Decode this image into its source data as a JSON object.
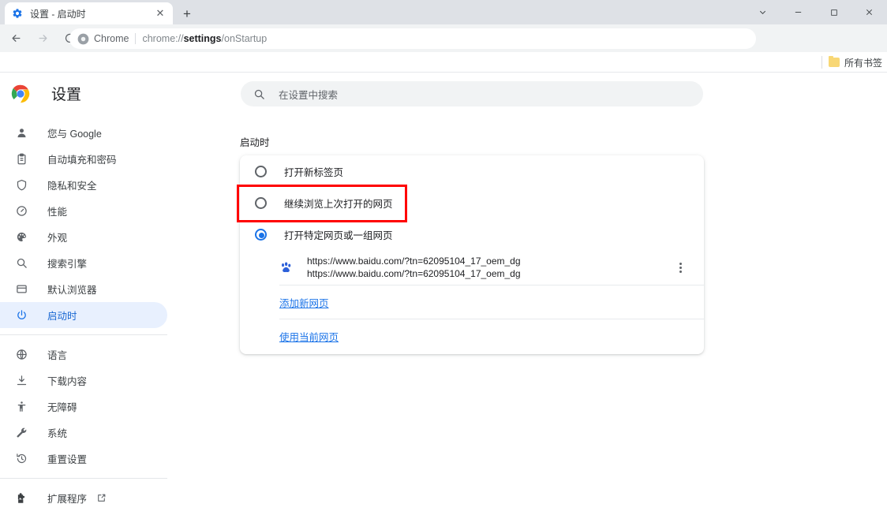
{
  "window": {
    "controls": [
      {
        "name": "chevron-down",
        "glyph": "⌄"
      },
      {
        "name": "minimize",
        "glyph": "—"
      },
      {
        "name": "maximize",
        "glyph": "□"
      },
      {
        "name": "close",
        "glyph": "✕"
      }
    ]
  },
  "tab": {
    "title": "设置 - 启动时",
    "favicon": "settings-gear-icon",
    "close_glyph": "✕",
    "new_tab_glyph": "+"
  },
  "toolbar": {
    "back_glyph": "←",
    "forward_glyph": "→",
    "reload_glyph": "⟳",
    "omnibox": {
      "chrome_label": "Chrome",
      "url_prefix": "chrome://",
      "url_bold": "settings",
      "url_suffix": "/onStartup"
    },
    "icons": [
      "share-icon",
      "bookmark-star-icon",
      "side-panel-icon",
      "profile-avatar-icon",
      "chrome-menu-icon"
    ]
  },
  "bookmarks": {
    "all_bookmarks_label": "所有书签"
  },
  "settings": {
    "brand_title": "设置",
    "search_placeholder": "在设置中搜索",
    "section_label": "启动时"
  },
  "sidebar": {
    "groups": [
      {
        "items": [
          {
            "label": "您与 Google",
            "icon": "person-icon",
            "active": false
          },
          {
            "label": "自动填充和密码",
            "icon": "clipboard-icon",
            "active": false
          },
          {
            "label": "隐私和安全",
            "icon": "shield-icon",
            "active": false
          },
          {
            "label": "性能",
            "icon": "gauge-icon",
            "active": false
          },
          {
            "label": "外观",
            "icon": "palette-icon",
            "active": false
          },
          {
            "label": "搜索引擎",
            "icon": "search-icon",
            "active": false
          },
          {
            "label": "默认浏览器",
            "icon": "browser-window-icon",
            "active": false
          },
          {
            "label": "启动时",
            "icon": "power-icon",
            "active": true
          }
        ]
      },
      {
        "items": [
          {
            "label": "语言",
            "icon": "globe-icon",
            "active": false
          },
          {
            "label": "下载内容",
            "icon": "download-icon",
            "active": false
          },
          {
            "label": "无障碍",
            "icon": "accessibility-icon",
            "active": false
          },
          {
            "label": "系统",
            "icon": "wrench-icon",
            "active": false
          },
          {
            "label": "重置设置",
            "icon": "restore-icon",
            "active": false
          }
        ]
      },
      {
        "items": [
          {
            "label": "扩展程序",
            "icon": "puzzle-icon",
            "active": false,
            "external": true
          }
        ]
      }
    ]
  },
  "startup": {
    "options": [
      {
        "label": "打开新标签页",
        "selected": false,
        "highlighted": false
      },
      {
        "label": "继续浏览上次打开的网页",
        "selected": false,
        "highlighted": true
      },
      {
        "label": "打开特定网页或一组网页",
        "selected": true,
        "highlighted": false
      }
    ],
    "pages": [
      {
        "favicon": "baidu-paw-icon",
        "line1": "https://www.baidu.com/?tn=62095104_17_oem_dg",
        "line2": "https://www.baidu.com/?tn=62095104_17_oem_dg"
      }
    ],
    "add_page_link": "添加新网页",
    "use_current_pages_link": "使用当前网页"
  },
  "colors": {
    "accent": "#1a73e8",
    "annotation": "#ff0000",
    "active_pill": "#e8f0fe",
    "tabstrip": "#dee1e6",
    "toolbar": "#f1f3f4"
  }
}
